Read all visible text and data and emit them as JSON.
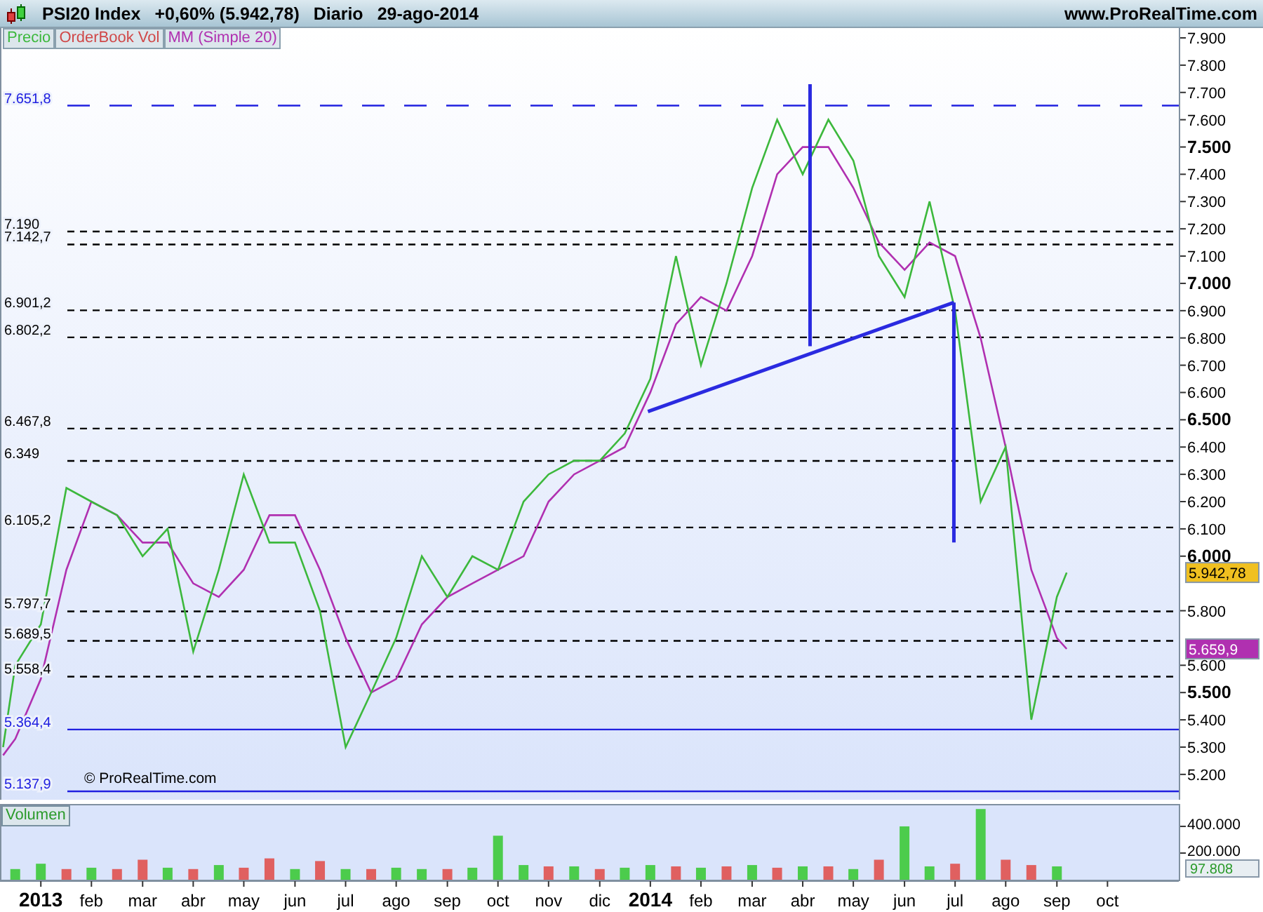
{
  "header": {
    "title": "PSI20 Index",
    "change": "+0,60% (5.942,78)",
    "period": "Diario",
    "date": "29-ago-2014",
    "site": "www.ProRealTime.com"
  },
  "price_chart": {
    "indicator": "OrderBook Vol",
    "copyright": "© ProRealTime.com",
    "price_tags": [
      {
        "label": "5.942,78",
        "color": "#f0c020"
      },
      {
        "label": "5.659,9",
        "color": "#b030b0"
      }
    ],
    "chart_data": {
      "type": "line",
      "x": [
        2012.938,
        2012.958,
        2013.0,
        2013.042,
        2013.083,
        2013.125,
        2013.167,
        2013.208,
        2013.25,
        2013.292,
        2013.333,
        2013.375,
        2013.417,
        2013.458,
        2013.5,
        2013.542,
        2013.583,
        2013.625,
        2013.667,
        2013.708,
        2013.75,
        2013.792,
        2013.833,
        2013.875,
        2013.917,
        2013.958,
        2014.0,
        2014.042,
        2014.083,
        2014.125,
        2014.167,
        2014.208,
        2014.25,
        2014.292,
        2014.333,
        2014.375,
        2014.417,
        2014.458,
        2014.5,
        2014.542,
        2014.583,
        2014.625,
        2014.667,
        2014.683
      ],
      "series": [
        {
          "name": "Precio",
          "color": "#3cb83c",
          "values": [
            5300,
            5600,
            5750,
            6250,
            6200,
            6150,
            6000,
            6100,
            5650,
            5950,
            6300,
            6050,
            6050,
            5800,
            5300,
            5500,
            5700,
            6000,
            5850,
            6000,
            5950,
            6200,
            6300,
            6350,
            6350,
            6450,
            6650,
            7100,
            6700,
            7000,
            7350,
            7600,
            7400,
            7600,
            7450,
            7100,
            6950,
            7300,
            6900,
            6200,
            6400,
            5400,
            5850,
            5940
          ]
        },
        {
          "name": "MM (Simple 20)",
          "color": "#b030b0",
          "values": [
            5270,
            5330,
            5550,
            5950,
            6200,
            6150,
            6050,
            6050,
            5900,
            5850,
            5950,
            6150,
            6150,
            5950,
            5700,
            5500,
            5550,
            5750,
            5850,
            5900,
            5950,
            6000,
            6200,
            6300,
            6350,
            6400,
            6600,
            6850,
            6950,
            6900,
            7100,
            7400,
            7500,
            7500,
            7350,
            7150,
            7050,
            7150,
            7100,
            6800,
            6400,
            5950,
            5700,
            5660
          ]
        }
      ],
      "xlim": [
        2012.933,
        2014.867
      ],
      "ylim": [
        5107,
        7936
      ],
      "ref_lines": [
        {
          "axis": "y",
          "value": 7651.8,
          "label": "7.651,8",
          "color": "#2020e0"
        },
        {
          "axis": "y",
          "value": 7190,
          "label": "7.190",
          "color": "#000000"
        },
        {
          "axis": "y",
          "value": 7142.7,
          "label": "7.142,7",
          "color": "#000000"
        },
        {
          "axis": "y",
          "value": 6901.2,
          "label": "6.901,2",
          "color": "#000000"
        },
        {
          "axis": "y",
          "value": 6802.2,
          "label": "6.802,2",
          "color": "#000000"
        },
        {
          "axis": "y",
          "value": 6467.8,
          "label": "6.467,8",
          "color": "#000000"
        },
        {
          "axis": "y",
          "value": 6349,
          "label": "6.349",
          "color": "#000000"
        },
        {
          "axis": "y",
          "value": 6105.2,
          "label": "6.105,2",
          "color": "#000000"
        },
        {
          "axis": "y",
          "value": 5797.7,
          "label": "5.797,7",
          "color": "#000000"
        },
        {
          "axis": "y",
          "value": 5689.5,
          "label": "5.689,5",
          "color": "#000000"
        },
        {
          "axis": "y",
          "value": 5558.4,
          "label": "5.558,4",
          "color": "#000000"
        },
        {
          "axis": "y",
          "value": 5364.4,
          "label": "5.364,4",
          "color": "#2020e0"
        },
        {
          "axis": "y",
          "value": 5137.9,
          "label": "5.137,9",
          "color": "#2020e0"
        }
      ],
      "yticks": [
        {
          "value": 7900,
          "label": "7.900"
        },
        {
          "value": 7800,
          "label": "7.800"
        },
        {
          "value": 7700,
          "label": "7.700"
        },
        {
          "value": 7600,
          "label": "7.600"
        },
        {
          "value": 7500,
          "label": "7.500"
        },
        {
          "value": 7400,
          "label": "7.400"
        },
        {
          "value": 7300,
          "label": "7.300"
        },
        {
          "value": 7200,
          "label": "7.200"
        },
        {
          "value": 7100,
          "label": "7.100"
        },
        {
          "value": 7000,
          "label": "7.000"
        },
        {
          "value": 6900,
          "label": "6.900"
        },
        {
          "value": 6800,
          "label": "6.800"
        },
        {
          "value": 6700,
          "label": "6.700"
        },
        {
          "value": 6600,
          "label": "6.600"
        },
        {
          "value": 6500,
          "label": "6.500"
        },
        {
          "value": 6400,
          "label": "6.400"
        },
        {
          "value": 6300,
          "label": "6.300"
        },
        {
          "value": 6200,
          "label": "6.200"
        },
        {
          "value": 6100,
          "label": "6.100"
        },
        {
          "value": 6000,
          "label": "6.000"
        },
        {
          "value": 5800,
          "label": "5.800"
        },
        {
          "value": 5600,
          "label": "5.600"
        },
        {
          "value": 5500,
          "label": "5.500"
        },
        {
          "value": 5400,
          "label": "5.400"
        },
        {
          "value": 5300,
          "label": "5.300"
        },
        {
          "value": 5200,
          "label": "5.200"
        }
      ]
    }
  },
  "volume_chart": {
    "value_tag": "97.808",
    "chart_data": {
      "type": "bar",
      "title": "Volumen",
      "x": [
        2012.958,
        2013.0,
        2013.042,
        2013.083,
        2013.125,
        2013.167,
        2013.208,
        2013.25,
        2013.292,
        2013.333,
        2013.375,
        2013.417,
        2013.458,
        2013.5,
        2013.542,
        2013.583,
        2013.625,
        2013.667,
        2013.708,
        2013.75,
        2013.792,
        2013.833,
        2013.875,
        2013.917,
        2013.958,
        2014.0,
        2014.042,
        2014.083,
        2014.125,
        2014.167,
        2014.208,
        2014.25,
        2014.292,
        2014.333,
        2014.375,
        2014.417,
        2014.458,
        2014.5,
        2014.542,
        2014.583,
        2014.625,
        2014.667
      ],
      "stacked": true,
      "series": [
        {
          "color": "#4ccc4c",
          "values": [
            80000,
            120000,
            null,
            90000,
            null,
            null,
            90000,
            null,
            110000,
            null,
            null,
            80000,
            null,
            80000,
            null,
            90000,
            80000,
            null,
            90000,
            330000,
            110000,
            null,
            100000,
            null,
            90000,
            110000,
            null,
            90000,
            null,
            110000,
            null,
            100000,
            null,
            80000,
            null,
            400000,
            100000,
            null,
            530000,
            null,
            null,
            100000
          ]
        },
        {
          "color": "#e06060",
          "values": [
            null,
            null,
            80000,
            null,
            80000,
            150000,
            null,
            80000,
            null,
            90000,
            160000,
            null,
            140000,
            null,
            80000,
            null,
            null,
            80000,
            null,
            null,
            null,
            100000,
            null,
            80000,
            null,
            null,
            100000,
            null,
            100000,
            null,
            90000,
            null,
            100000,
            null,
            150000,
            null,
            null,
            120000,
            null,
            150000,
            110000,
            null
          ]
        }
      ],
      "xlim": [
        2012.933,
        2014.867
      ],
      "ylim": [
        0,
        568000
      ],
      "yticks": [
        {
          "value": 400000,
          "label": "400.000"
        },
        {
          "value": 200000,
          "label": "200.000"
        }
      ],
      "xticks": [
        {
          "value": 2013,
          "label": "2013"
        },
        {
          "value": 2013.083,
          "label": "feb"
        },
        {
          "value": 2013.167,
          "label": "mar"
        },
        {
          "value": 2013.25,
          "label": "abr"
        },
        {
          "value": 2013.333,
          "label": "may"
        },
        {
          "value": 2013.417,
          "label": "jun"
        },
        {
          "value": 2013.5,
          "label": "jul"
        },
        {
          "value": 2013.583,
          "label": "ago"
        },
        {
          "value": 2013.667,
          "label": "sep"
        },
        {
          "value": 2013.75,
          "label": "oct"
        },
        {
          "value": 2013.833,
          "label": "nov"
        },
        {
          "value": 2013.917,
          "label": "dic"
        },
        {
          "value": 2014,
          "label": "2014"
        },
        {
          "value": 2014.083,
          "label": "feb"
        },
        {
          "value": 2014.167,
          "label": "mar"
        },
        {
          "value": 2014.25,
          "label": "abr"
        },
        {
          "value": 2014.333,
          "label": "may"
        },
        {
          "value": 2014.417,
          "label": "jun"
        },
        {
          "value": 2014.5,
          "label": "jul"
        },
        {
          "value": 2014.583,
          "label": "ago"
        },
        {
          "value": 2014.667,
          "label": "sep"
        },
        {
          "value": 2014.75,
          "label": "oct"
        }
      ]
    }
  }
}
